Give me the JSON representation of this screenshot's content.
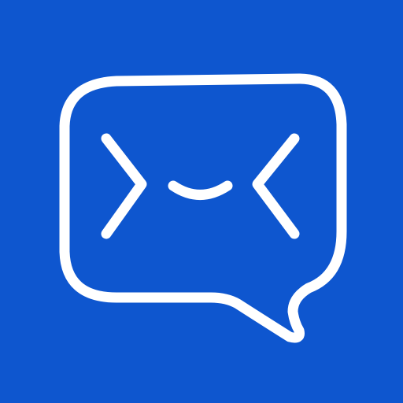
{
  "icon": {
    "name": "chat-bubble-envelope-icon",
    "background_color": "#0E56CF",
    "foreground_color": "#FFFFFF",
    "parts": [
      "speech-bubble-outline",
      "left-chevron",
      "smile-curve",
      "right-chevron"
    ]
  }
}
